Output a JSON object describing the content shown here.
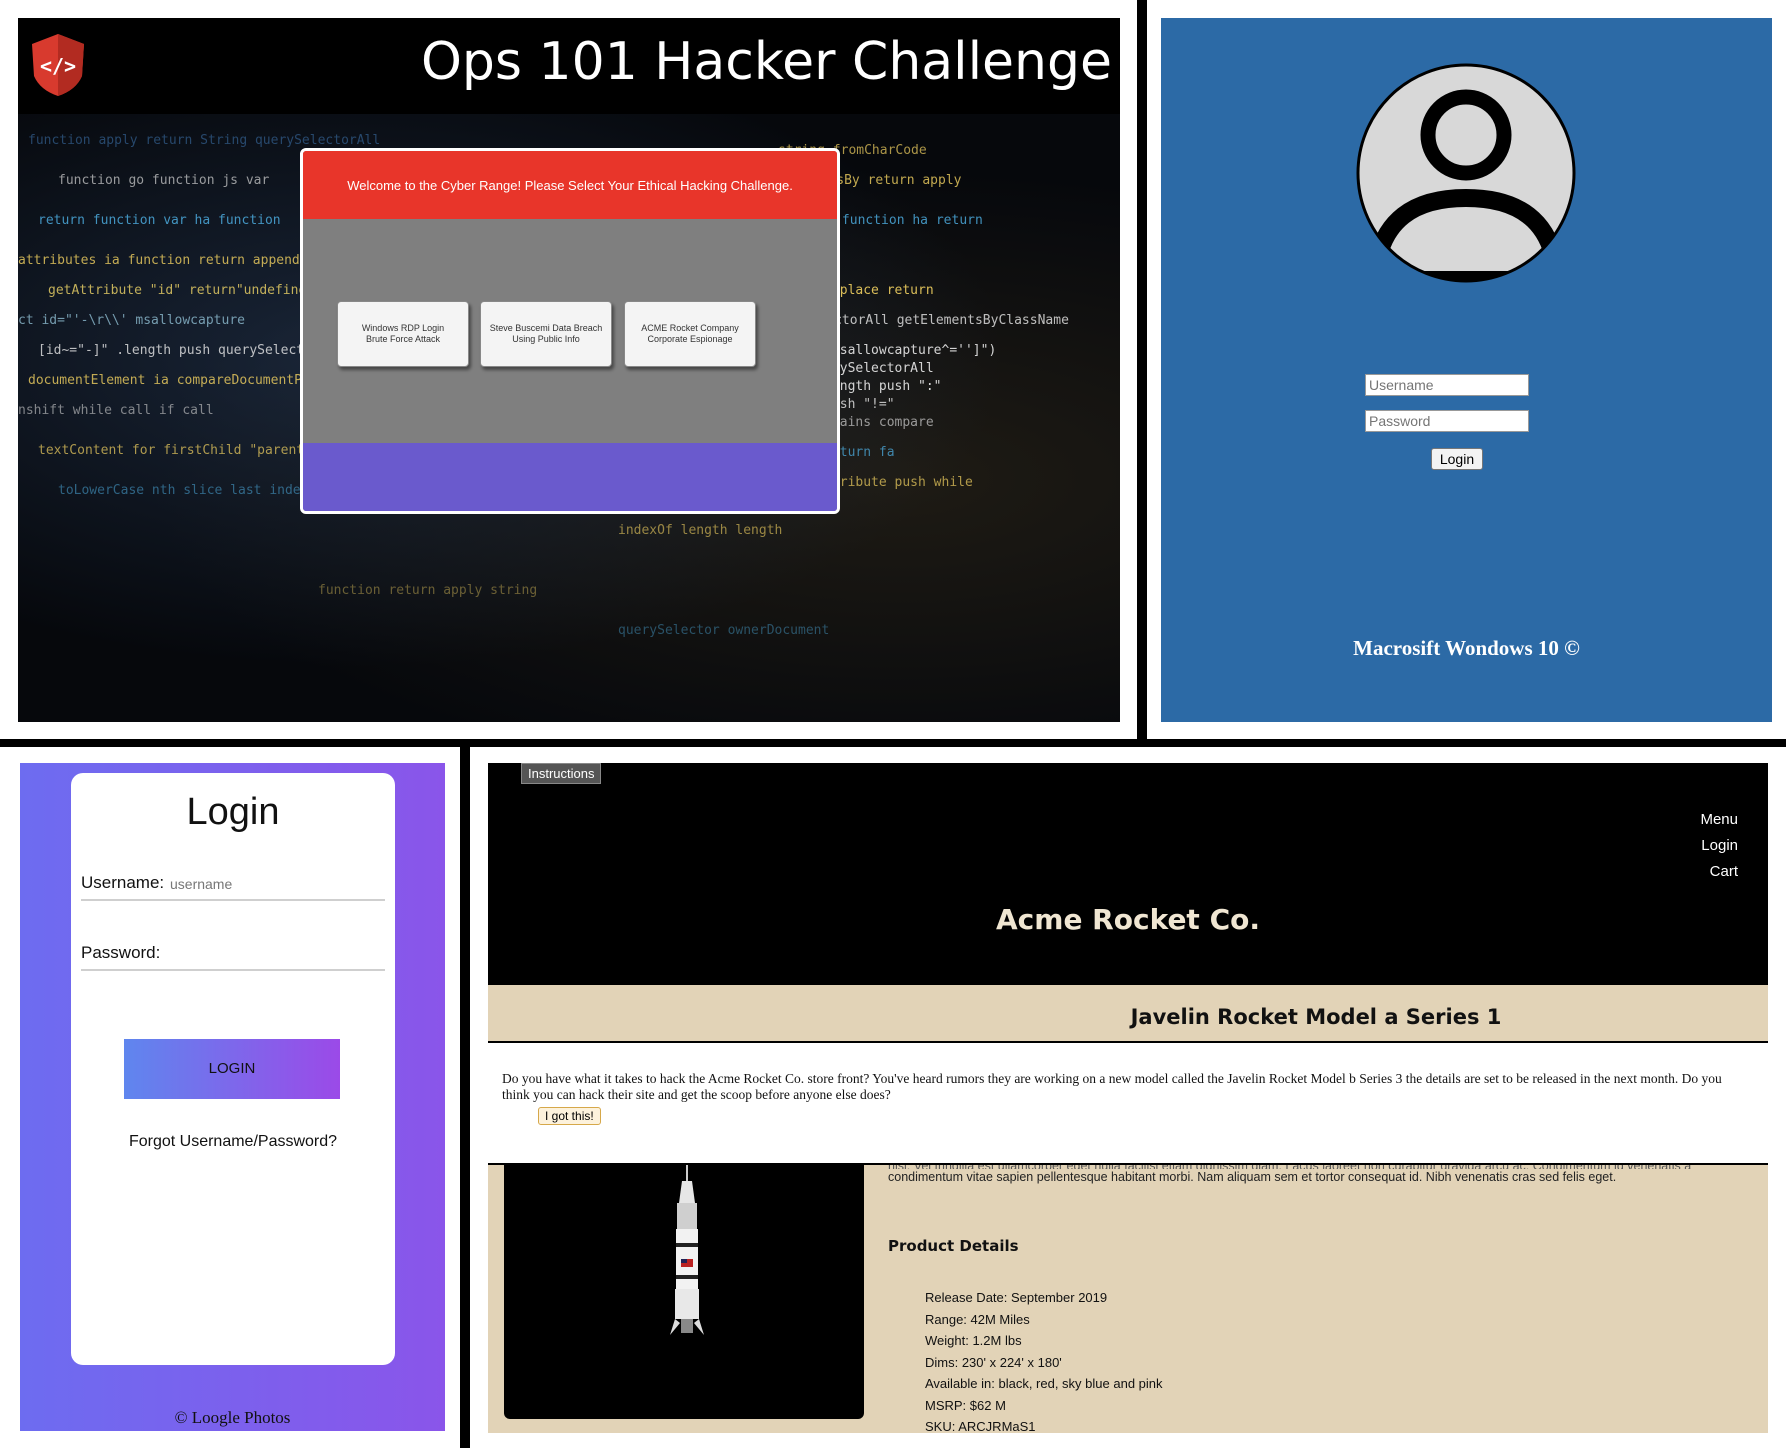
{
  "ops": {
    "title": "Ops 101 Hacker Challenge",
    "modal_heading": "Welcome to the Cyber Range! Please Select Your Ethical Hacking Challenge.",
    "challenges": [
      {
        "label": "Windows RDP Login\nBrute Force Attack"
      },
      {
        "label": "Steve Buscemi Data Breach\nUsing Public Info"
      },
      {
        "label": "ACME Rocket Company\nCorporate Espionage"
      }
    ],
    "colors": {
      "header": "#e8352a",
      "body": "#7f7f7f",
      "footer": "#6a5acd"
    }
  },
  "windows": {
    "username_placeholder": "Username",
    "password_placeholder": "Password",
    "login_label": "Login",
    "brand": "Macrosift Wondows 10 ©",
    "background": "#2c6aa6"
  },
  "loogle": {
    "heading": "Login",
    "username_label": "Username:",
    "username_placeholder": "username",
    "password_label": "Password:",
    "login_button": "LOGIN",
    "forgot": "Forgot Username/Password?",
    "copyright": "© Loogle Photos"
  },
  "acme": {
    "instructions": "Instructions",
    "menu": [
      "Menu",
      "Login",
      "Cart"
    ],
    "store_name": "Acme Rocket Co.",
    "product_title": "Javelin Rocket Model a Series 1",
    "overlay_text": "Do you have what it takes to hack the Acme Rocket Co. store front? You've heard rumors they are working on a new model called the Javelin Rocket Model b Series 3 the details are set to be released in the next month. Do you think you can hack their site and get the scoop before anyone else does?",
    "got_it": "I got this!",
    "lorem_cut": "nisl. Vel fringilla est ullamcorper eget nulla facilisi etiam dignissim diam. Lacus laoreet non curabitur gravida arcu ac. Condimentum id venenatis a",
    "lorem": "condimentum vitae sapien pellentesque habitant morbi. Nam aliquam sem et tortor consequat id. Nibh venenatis cras sed felis eget.",
    "details_heading": "Product Details",
    "details": [
      "Release Date: September 2019",
      "Range: 42M Miles",
      "Weight: 1.2M lbs",
      "Dims: 230' x 224' x 180'",
      "Available in: black, red, sky blue and pink",
      "MSRP: $62 M",
      "SKU: ARCJRMaS1"
    ]
  }
}
